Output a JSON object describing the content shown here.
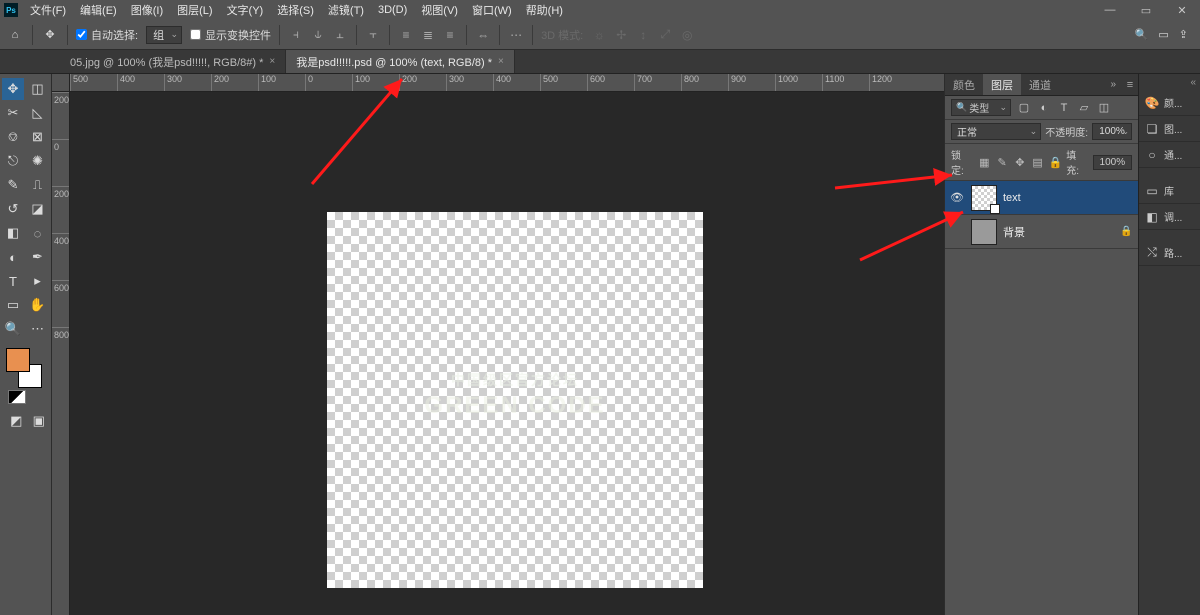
{
  "menu": {
    "items": [
      "文件(F)",
      "编辑(E)",
      "图像(I)",
      "图层(L)",
      "文字(Y)",
      "选择(S)",
      "滤镜(T)",
      "3D(D)",
      "视图(V)",
      "窗口(W)",
      "帮助(H)"
    ]
  },
  "options": {
    "auto_select_label": "自动选择:",
    "auto_select_value": "组",
    "transform_controls_label": "显示变换控件",
    "mode3d_label": "3D 模式:"
  },
  "tabs": [
    {
      "label": "05.jpg @ 100% (我是psd!!!!!, RGB/8#) *",
      "active": false
    },
    {
      "label": "我是psd!!!!!.psd @ 100% (text, RGB/8) *",
      "active": true
    }
  ],
  "ruler_h": [
    "500",
    "400",
    "300",
    "200",
    "100",
    "0",
    "100",
    "200",
    "300",
    "400",
    "500",
    "600",
    "700",
    "800",
    "900",
    "1000",
    "1100",
    "1200"
  ],
  "ruler_v": [
    "200",
    "0",
    "200",
    "400",
    "600",
    "800"
  ],
  "canvas_text_line1": "中国级区官方论坛",
  "canvas_text_line2": "GREEN CODE",
  "panels": {
    "top_tabs": {
      "color": "颜色",
      "layers": "图层",
      "channels": "通道"
    },
    "filter_label": "类型",
    "blend_mode": "正常",
    "opacity_label": "不透明度:",
    "opacity_value": "100%",
    "lock_label": "锁定:",
    "fill_label": "填充:",
    "fill_value": "100%",
    "layer_list": [
      {
        "name": "text",
        "selected": true,
        "visible": true,
        "locked": false
      },
      {
        "name": "背景",
        "selected": false,
        "visible": true,
        "locked": true
      }
    ]
  },
  "strip": {
    "items": [
      {
        "icon": "🎨",
        "label": "颜..."
      },
      {
        "icon": "❏",
        "label": "图..."
      },
      {
        "icon": "○",
        "label": "通..."
      },
      {
        "icon": "▭",
        "label": "库"
      },
      {
        "icon": "◧",
        "label": "调..."
      },
      {
        "icon": "⤭",
        "label": "路..."
      }
    ]
  },
  "right_icons": {
    "search": "🔍",
    "arrange": "▭",
    "share": "⇪"
  }
}
